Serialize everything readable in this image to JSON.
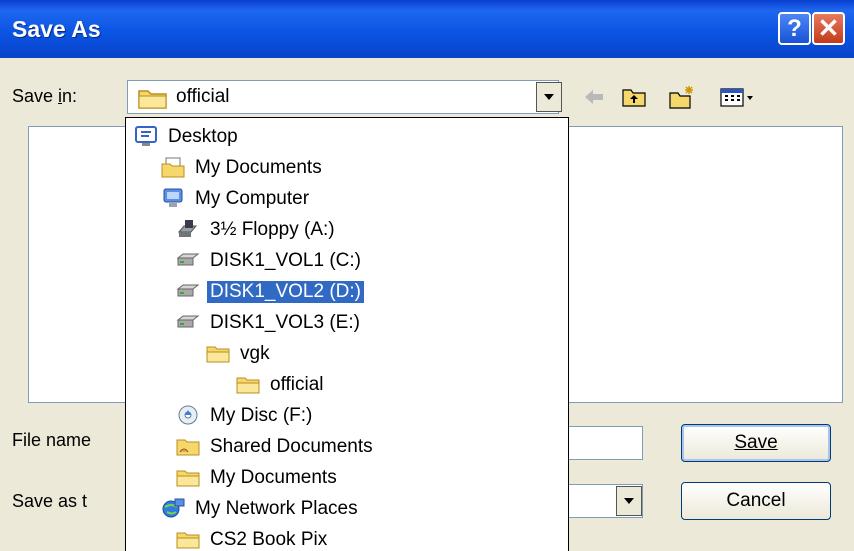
{
  "window": {
    "title": "Save As"
  },
  "toolbar": {
    "save_in_label": "Save in:",
    "save_in_value": "official"
  },
  "dropdown": {
    "items": [
      {
        "label": "Desktop",
        "icon": "desktop-icon",
        "level": 0,
        "selected": false
      },
      {
        "label": "My Documents",
        "icon": "documents-folder-icon",
        "level": 1,
        "selected": false
      },
      {
        "label": "My Computer",
        "icon": "computer-icon",
        "level": 1,
        "selected": false
      },
      {
        "label": "3½ Floppy (A:)",
        "icon": "floppy-drive-icon",
        "level": 2,
        "selected": false
      },
      {
        "label": "DISK1_VOL1 (C:)",
        "icon": "hard-drive-icon",
        "level": 2,
        "selected": false
      },
      {
        "label": "DISK1_VOL2 (D:)",
        "icon": "hard-drive-icon",
        "level": 2,
        "selected": true
      },
      {
        "label": "DISK1_VOL3 (E:)",
        "icon": "hard-drive-icon",
        "level": 2,
        "selected": false
      },
      {
        "label": "vgk",
        "icon": "folder-icon",
        "level": 3,
        "selected": false
      },
      {
        "label": "official",
        "icon": "folder-icon",
        "level": 4,
        "selected": false
      },
      {
        "label": "My Disc (F:)",
        "icon": "cd-drive-icon",
        "level": 2,
        "selected": false
      },
      {
        "label": "Shared Documents",
        "icon": "shared-folder-icon",
        "level": 2,
        "selected": false
      },
      {
        "label": "My Documents",
        "icon": "folder-icon",
        "level": 2,
        "selected": false
      },
      {
        "label": "My Network Places",
        "icon": "network-places-icon",
        "level": 1,
        "selected": false
      },
      {
        "label": "CS2 Book Pix",
        "icon": "folder-icon",
        "level": 2,
        "selected": false
      }
    ]
  },
  "form": {
    "file_name_label": "File name",
    "save_as_type_label": "Save as t",
    "save_button": "Save",
    "cancel_button": "Cancel"
  },
  "colors": {
    "title_bar": "#0b55e4",
    "selection": "#316ac5",
    "dialog_bg": "#ece9d8"
  }
}
